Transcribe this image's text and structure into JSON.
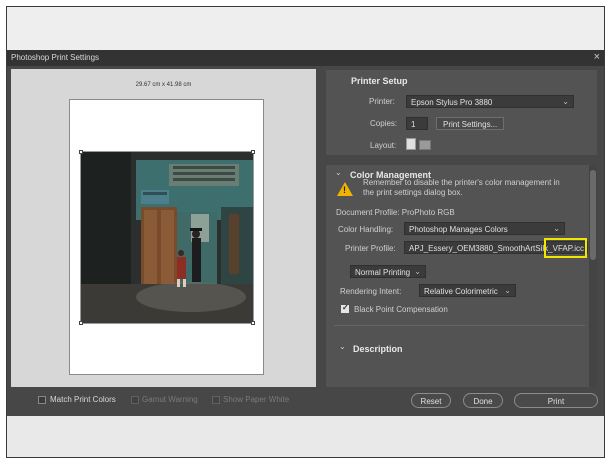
{
  "window": {
    "title": "Photoshop Print Settings",
    "close_glyph": "×"
  },
  "preview": {
    "dimensions": "29.67 cm x 41.98 cm"
  },
  "printer_setup": {
    "title": "Printer Setup",
    "printer_label": "Printer:",
    "printer_value": "Epson Stylus Pro 3880",
    "copies_label": "Copies:",
    "copies_value": "1",
    "print_settings_button": "Print Settings...",
    "layout_label": "Layout:"
  },
  "color_management": {
    "title": "Color Management",
    "warning": "Remember to disable the printer's color management in the print settings dialog box.",
    "document_profile": "Document Profile: ProPhoto RGB",
    "color_handling_label": "Color Handling:",
    "color_handling_value": "Photoshop Manages Colors",
    "printer_profile_label": "Printer Profile:",
    "printer_profile_value": "APJ_Essery_OEM3880_SmoothArtSilk_VFAP.icc",
    "normal_printing_value": "Normal Printing",
    "rendering_intent_label": "Rendering Intent:",
    "rendering_intent_value": "Relative Colorimetric",
    "black_point_label": "Black Point Compensation",
    "black_point_checked": true
  },
  "description": {
    "title": "Description"
  },
  "bottom": {
    "match_print_colors": "Match Print Colors",
    "gamut_warning": "Gamut Warning",
    "show_paper_white": "Show Paper White",
    "reset": "Reset",
    "done": "Done",
    "print": "Print"
  },
  "colors": {
    "highlight": "#f2e600",
    "warning": "#f0b400",
    "dialog_bg": "#474747"
  }
}
